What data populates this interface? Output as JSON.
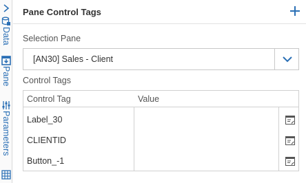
{
  "sidebar": {
    "items": [
      {
        "label": "Data",
        "icon": "database-icon"
      },
      {
        "label": "Pane",
        "icon": "pane-download-icon"
      },
      {
        "label": "Parameters",
        "icon": "sliders-icon"
      },
      {
        "label": "",
        "icon": "table-grid-icon"
      }
    ]
  },
  "header": {
    "title": "Pane Control Tags",
    "add_icon": "plus-icon"
  },
  "selection_pane": {
    "label": "Selection Pane",
    "value": "[AN30] Sales - Client"
  },
  "control_tags": {
    "label": "Control Tags",
    "columns": [
      "Control Tag",
      "Value"
    ],
    "rows": [
      {
        "tag": "Label_30",
        "value": ""
      },
      {
        "tag": "CLIENTID",
        "value": ""
      },
      {
        "tag": "Button_-1",
        "value": ""
      }
    ]
  },
  "colors": {
    "accent": "#2a6fb5",
    "border": "#d0d0d0",
    "text": "#333333"
  }
}
